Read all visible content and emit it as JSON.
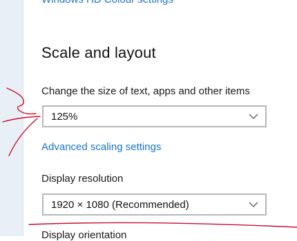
{
  "colors": {
    "link": "#1a73c9",
    "rail": "#e8eff6",
    "annotation": "#c8102e"
  },
  "header": {
    "cut_off_link": "Windows HD Colour settings"
  },
  "scale_layout": {
    "title": "Scale and layout",
    "size_label": "Change the size of text, apps and other items",
    "size_value": "125%",
    "advanced_link": "Advanced scaling settings",
    "resolution_label": "Display resolution",
    "resolution_value": "1920 × 1080 (Recommended)",
    "orientation_label": "Display orientation"
  },
  "icons": {
    "dropdown": "chevron-down-icon"
  }
}
